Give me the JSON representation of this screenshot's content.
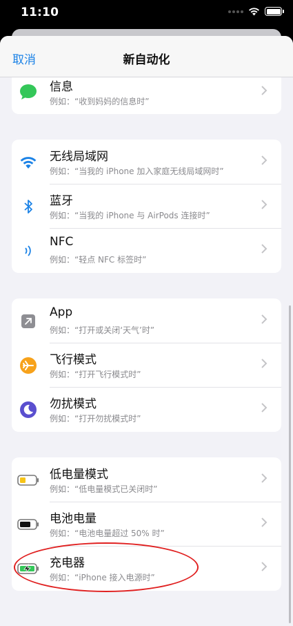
{
  "status_bar": {
    "time": "11:10"
  },
  "nav": {
    "cancel_label": "取消",
    "title": "新自动化"
  },
  "groups": [
    {
      "rows": [
        {
          "title": "信息",
          "subtitle": "例如：“收到妈妈的信息时”",
          "icon": "message-icon"
        }
      ]
    },
    {
      "rows": [
        {
          "title": "无线局域网",
          "subtitle": "例如：“当我的 iPhone 加入家庭无线局域网时”",
          "icon": "wifi-icon"
        },
        {
          "title": "蓝牙",
          "subtitle": "例如：“当我的 iPhone 与 AirPods 连接时”",
          "icon": "bluetooth-icon"
        },
        {
          "title": "NFC",
          "subtitle": "例如：“轻点 NFC 标签时”",
          "icon": "nfc-icon"
        }
      ]
    },
    {
      "rows": [
        {
          "title": "App",
          "subtitle": "例如：“打开或关闭‘天气’时”",
          "icon": "app-icon"
        },
        {
          "title": "飞行模式",
          "subtitle": "例如：“打开飞行模式时”",
          "icon": "airplane-icon"
        },
        {
          "title": "勿扰模式",
          "subtitle": "例如：“打开勿扰模式时”",
          "icon": "moon-icon"
        }
      ]
    },
    {
      "rows": [
        {
          "title": "低电量模式",
          "subtitle": "例如：“低电量模式已关闭时”",
          "icon": "low-battery-icon"
        },
        {
          "title": "电池电量",
          "subtitle": "例如：“电池电量超过 50% 时”",
          "icon": "battery-icon"
        },
        {
          "title": "充电器",
          "subtitle": "例如：“iPhone 接入电源时”",
          "icon": "charging-icon"
        }
      ]
    }
  ],
  "colors": {
    "accent": "#1b82e6",
    "message_green": "#34c759",
    "airplane_orange": "#f7a21b",
    "moon_purple": "#5a4fcf",
    "annotation_red": "#e02020"
  }
}
